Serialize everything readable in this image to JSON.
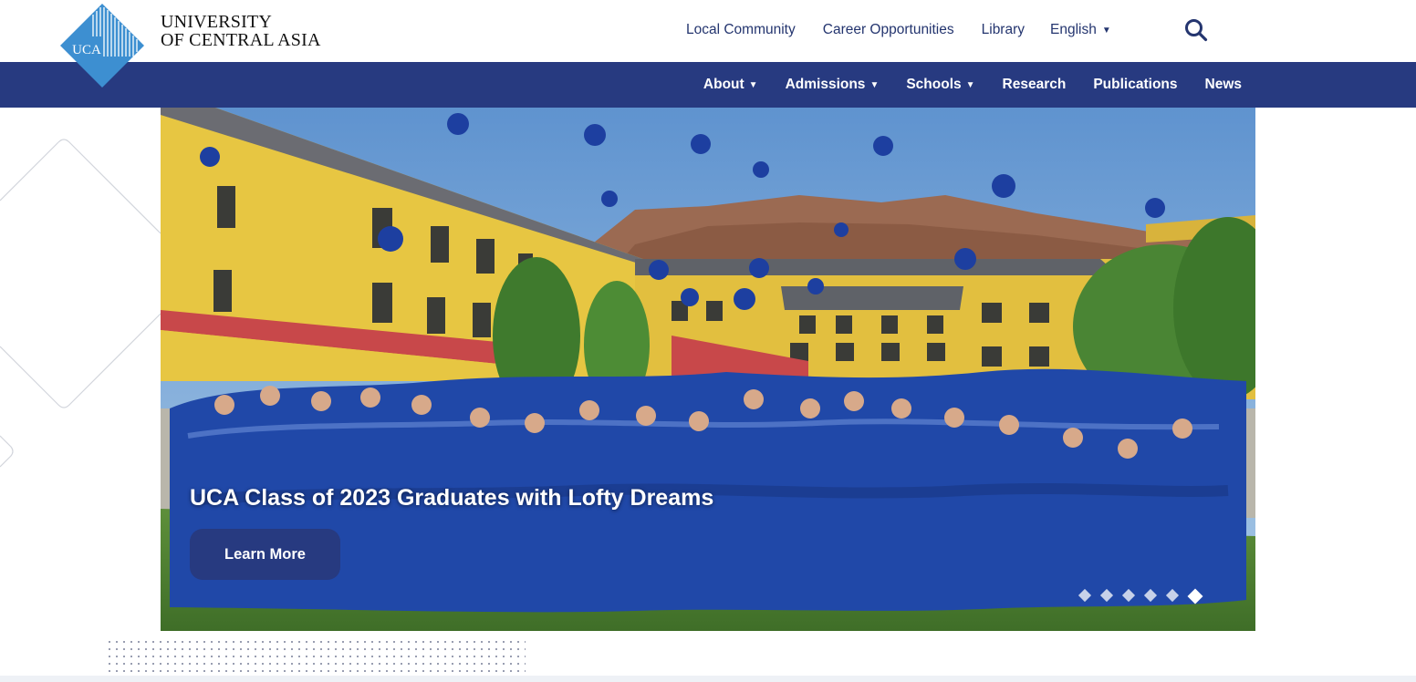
{
  "logo": {
    "mark_text": "UCA",
    "line1": "UNIVERSITY",
    "line2": "OF CENTRAL ASIA"
  },
  "utility_nav": {
    "items": [
      "Local Community",
      "Career Opportunities",
      "Library"
    ],
    "language": "English"
  },
  "main_nav": {
    "items": [
      {
        "label": "About",
        "dropdown": true
      },
      {
        "label": "Admissions",
        "dropdown": true
      },
      {
        "label": "Schools",
        "dropdown": true
      },
      {
        "label": "Research",
        "dropdown": false
      },
      {
        "label": "Publications",
        "dropdown": false
      },
      {
        "label": "News",
        "dropdown": false
      }
    ]
  },
  "hero": {
    "title": "UCA Class of 2023 Graduates with Lofty Dreams",
    "button": "Learn More",
    "slide_count": 6,
    "active_slide": 6
  },
  "colors": {
    "brand_navy": "#273a80",
    "brand_light_blue": "#3d8fd1",
    "link_text": "#24356f"
  },
  "icons": [
    "uca-logo-icon",
    "search-icon",
    "chevron-down-icon"
  ]
}
